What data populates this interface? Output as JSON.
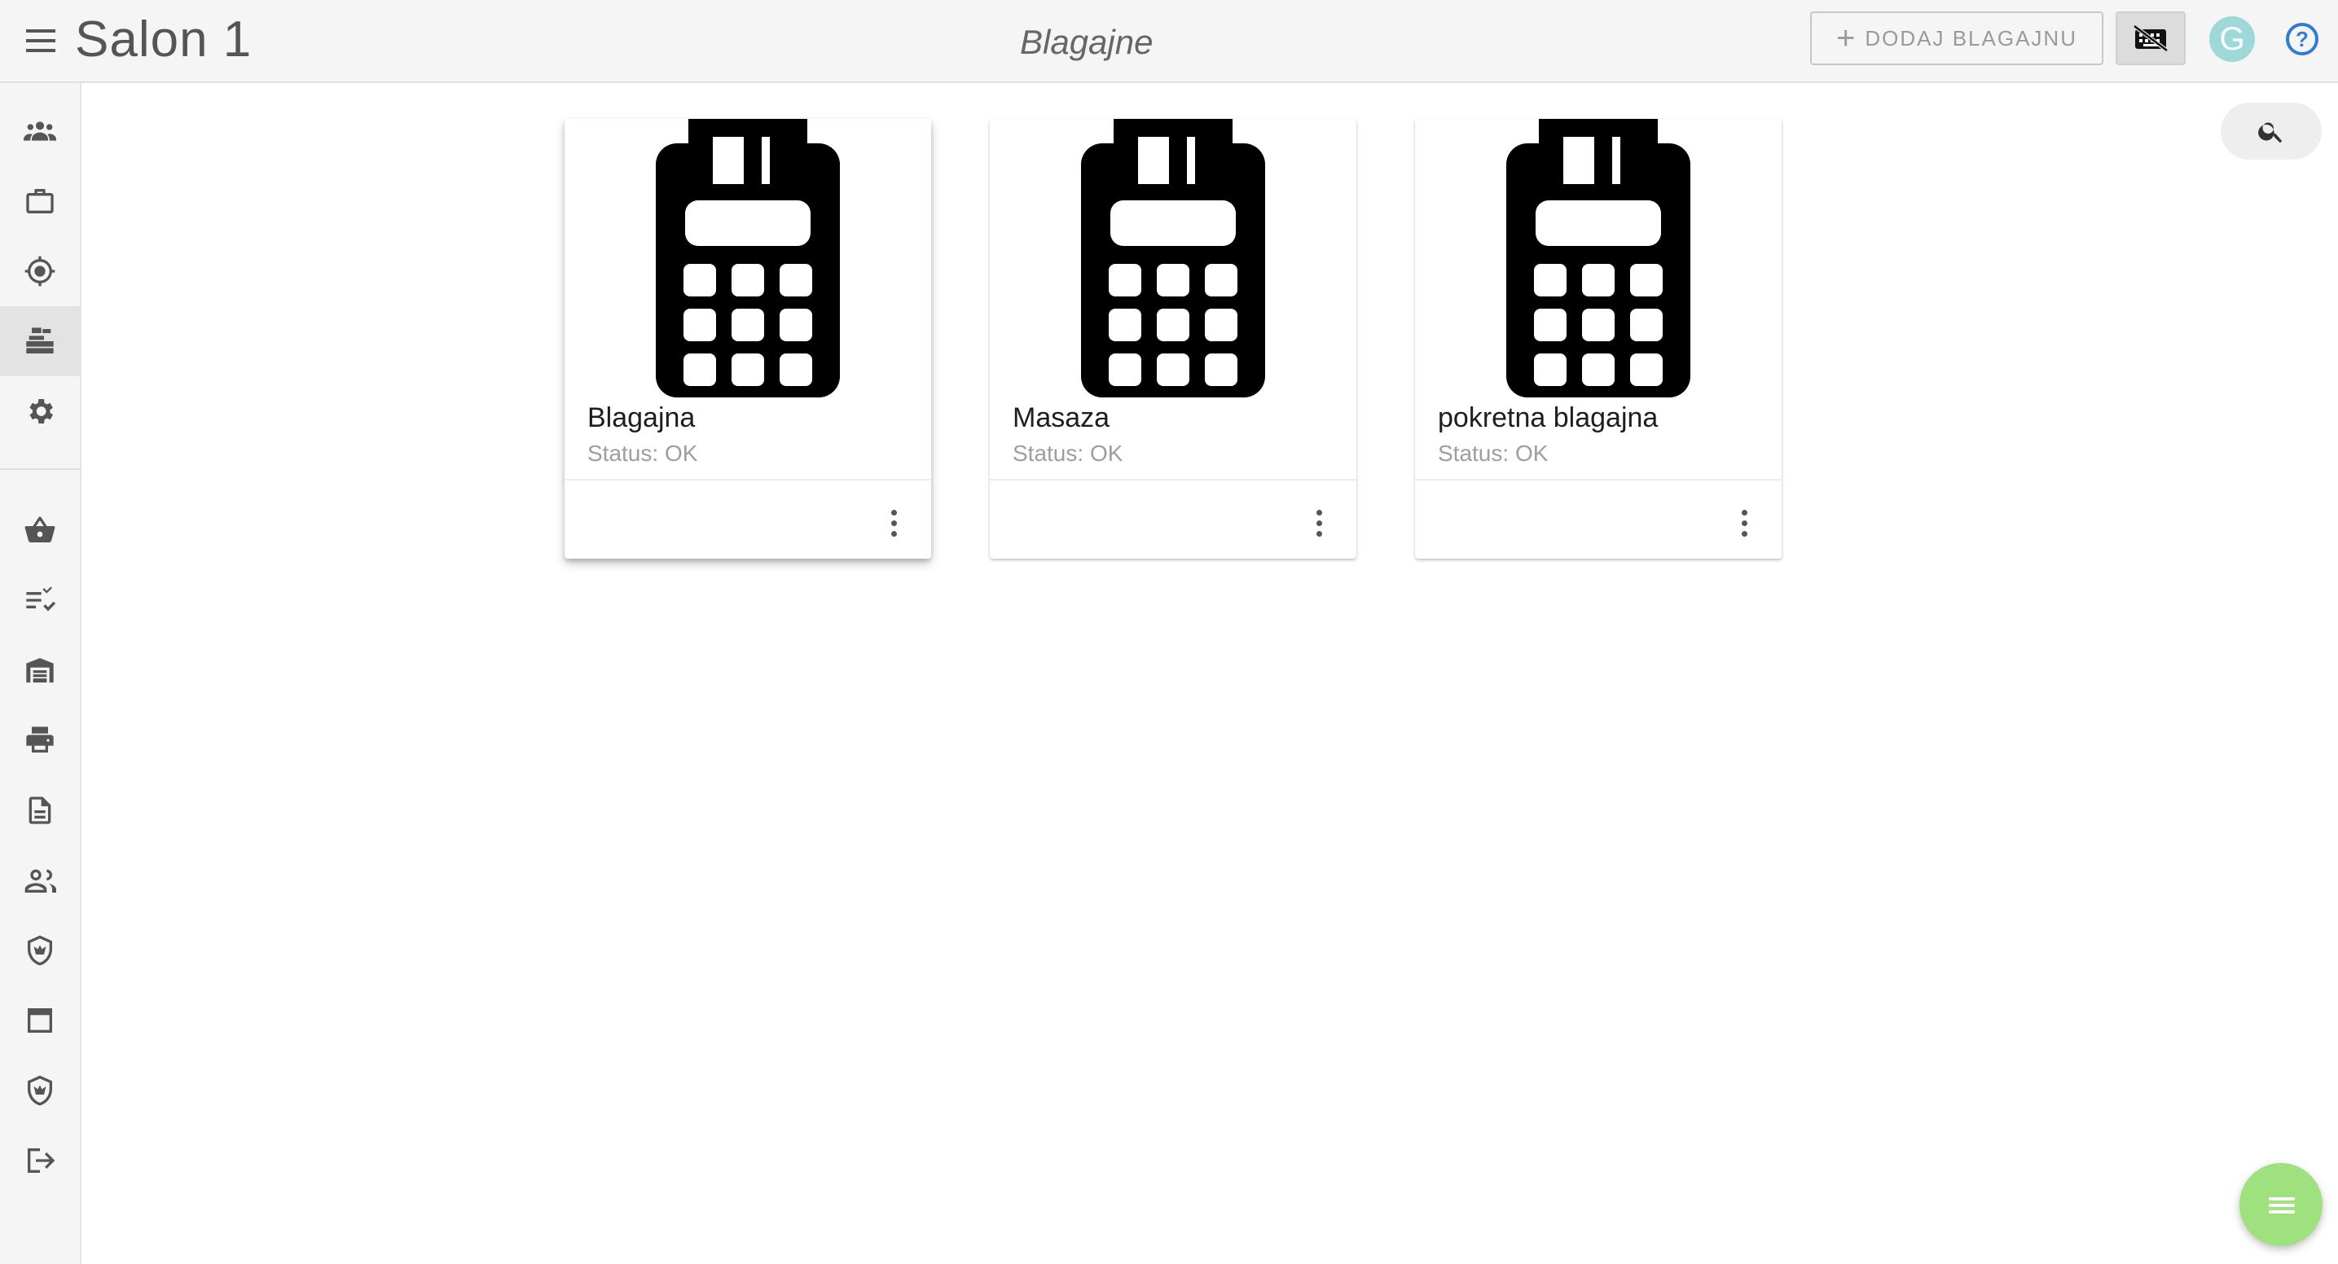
{
  "header": {
    "app_title": "Salon 1",
    "page_title": "Blagajne",
    "add_button_label": "DODAJ BLAGAJNU",
    "avatar_letter": "G",
    "help_label": "?",
    "avatar_color": "#9fd8d9",
    "help_color": "#2f7dd3"
  },
  "sidebar": {
    "items": [
      {
        "icon": "users-group-icon",
        "active": false
      },
      {
        "icon": "briefcase-icon",
        "active": false
      },
      {
        "icon": "location-target-icon",
        "active": false
      },
      {
        "icon": "cash-register-icon",
        "active": true
      },
      {
        "icon": "gear-icon",
        "active": false
      },
      {
        "icon": "basket-icon",
        "active": false
      },
      {
        "icon": "checklist-icon",
        "active": false
      },
      {
        "icon": "warehouse-icon",
        "active": false
      },
      {
        "icon": "printer-icon",
        "active": false
      },
      {
        "icon": "document-icon",
        "active": false
      },
      {
        "icon": "people-icon",
        "active": false
      },
      {
        "icon": "shield-crown-icon",
        "active": false
      },
      {
        "icon": "window-icon",
        "active": false
      },
      {
        "icon": "shield-crown-icon",
        "active": false
      },
      {
        "icon": "logout-icon",
        "active": false
      }
    ]
  },
  "registers": [
    {
      "name": "Blagajna",
      "status": "Status: OK"
    },
    {
      "name": "Masaza",
      "status": "Status: OK"
    },
    {
      "name": "pokretna blagajna",
      "status": "Status: OK"
    }
  ],
  "fab": {
    "icon": "menu-lines-icon",
    "color": "#9fe07f"
  }
}
